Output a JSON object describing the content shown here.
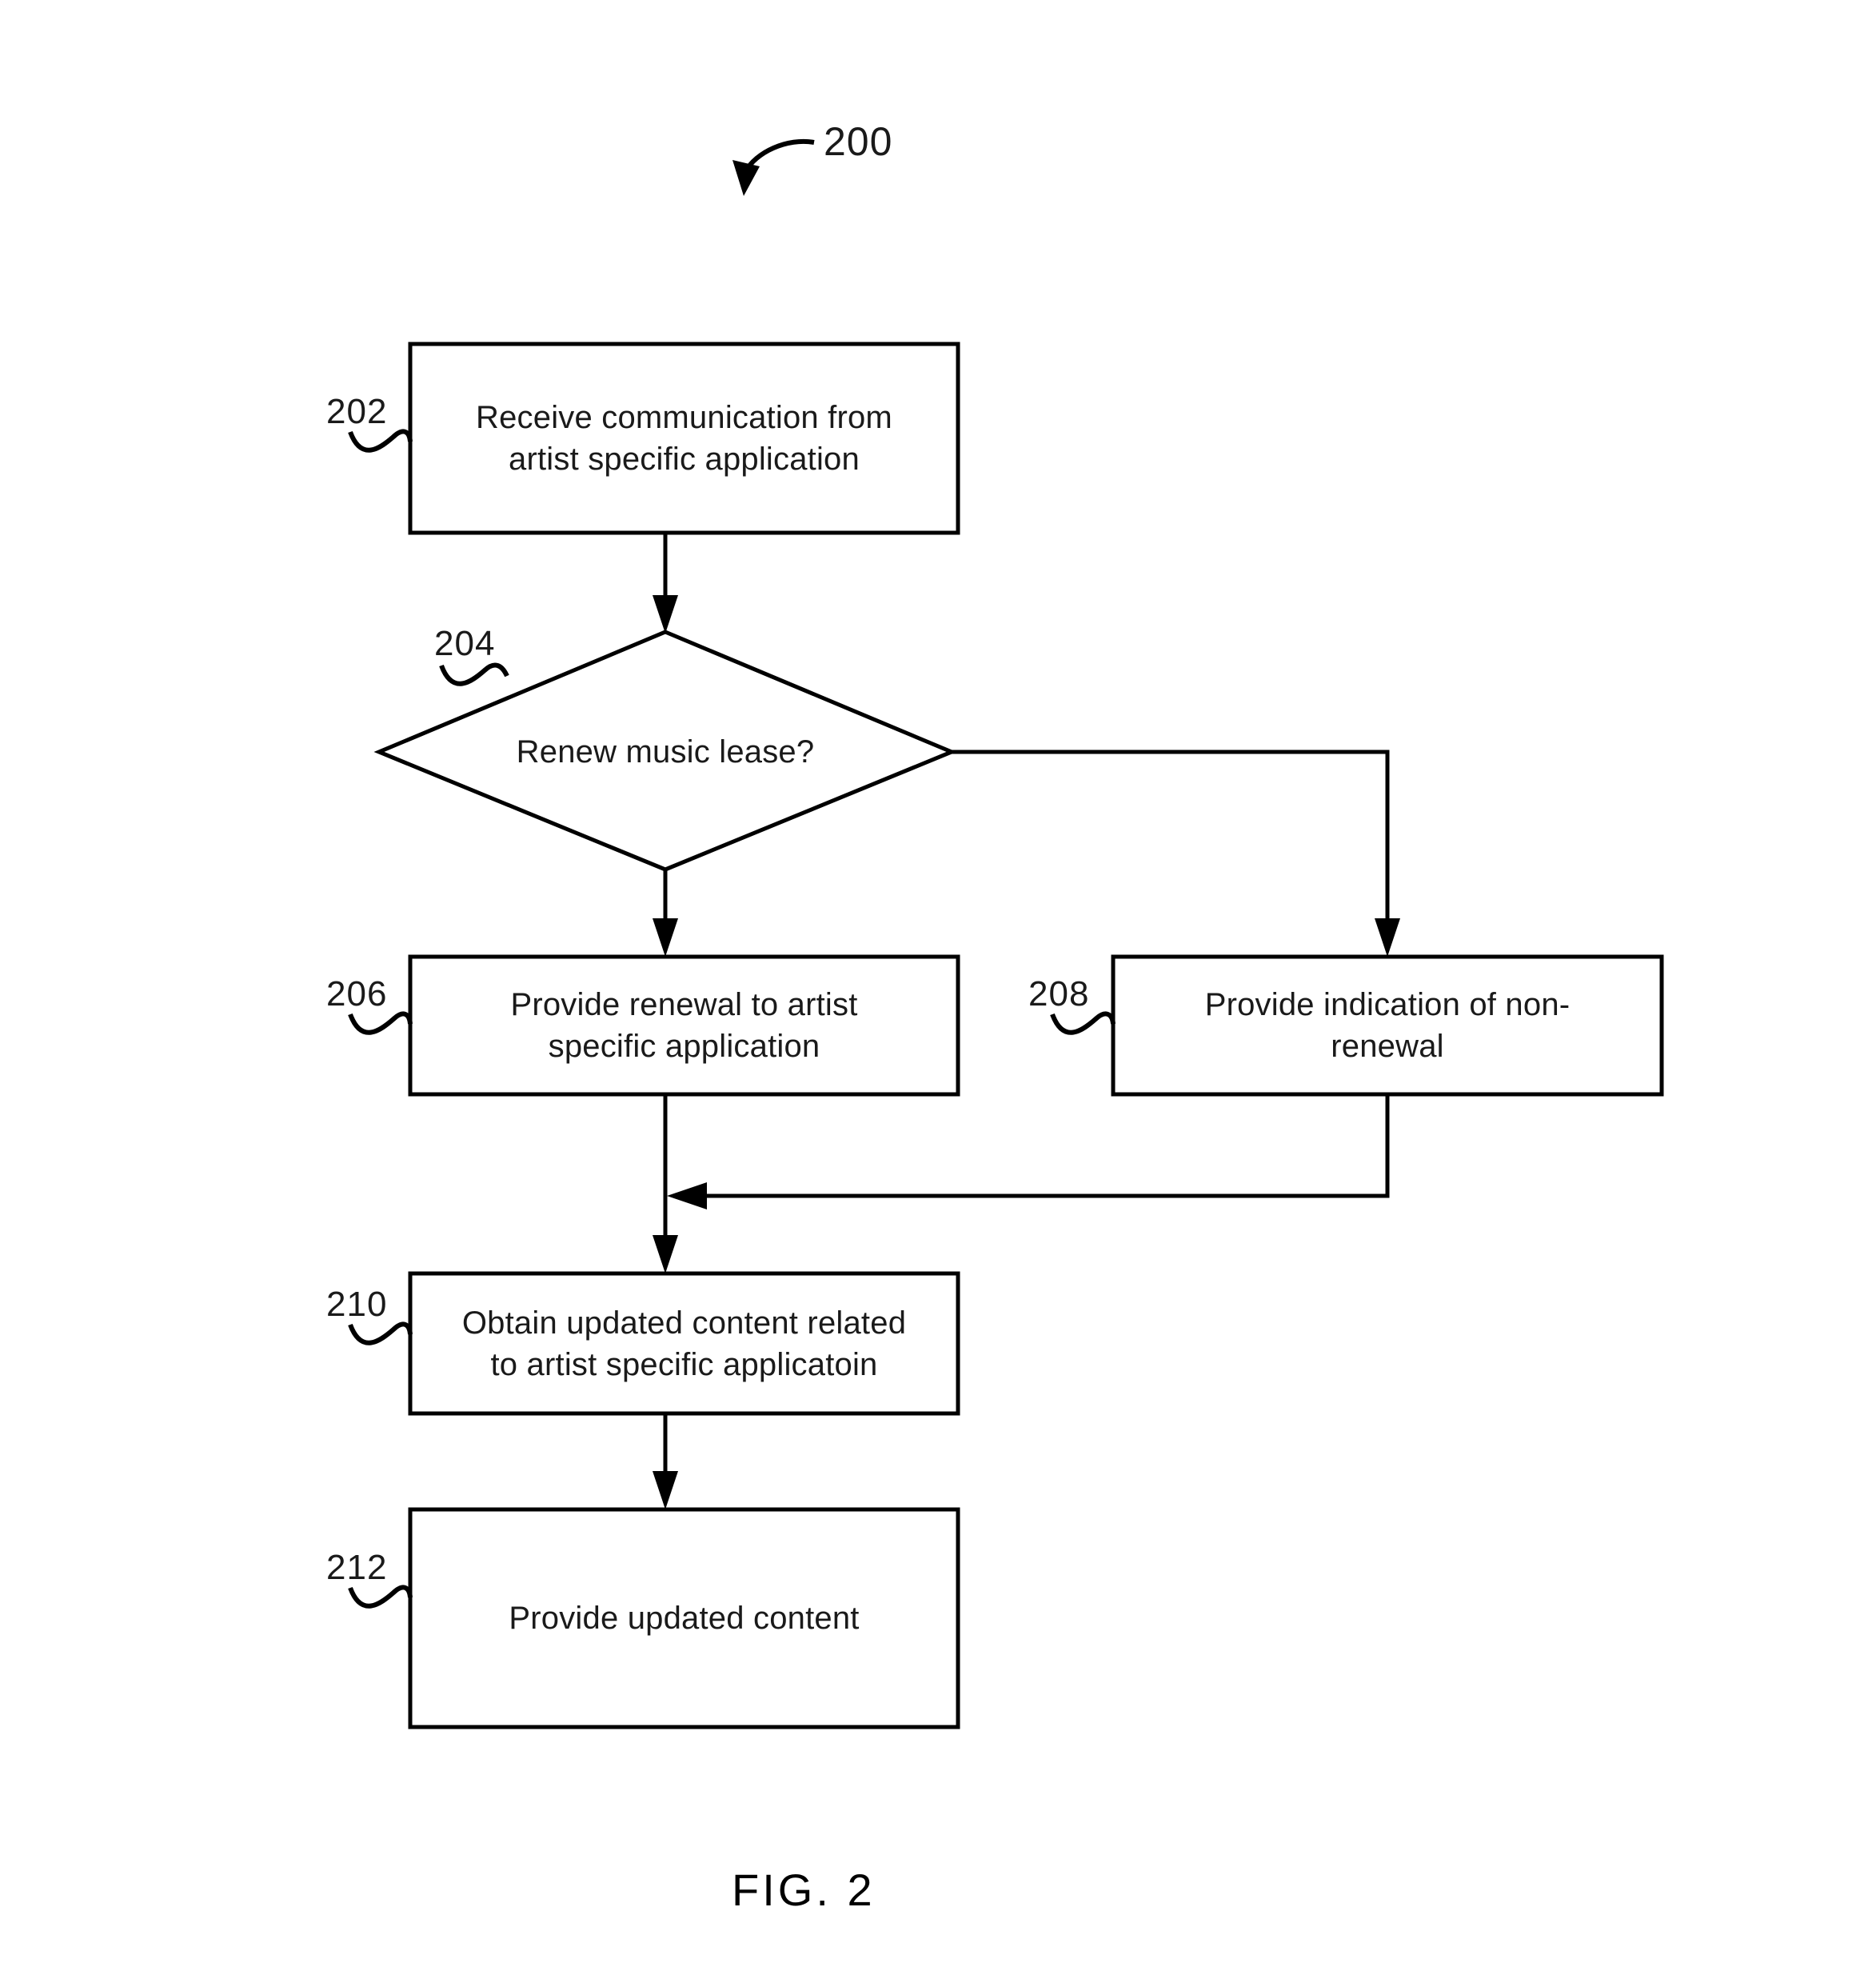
{
  "figure": {
    "caption": "FIG. 2",
    "diagram_ref": "200",
    "background_color": "#ffffff",
    "line_color": "#000000",
    "text_color": "#1a1a1a"
  },
  "nodes": [
    {
      "id": "step-202",
      "ref": "202",
      "shape": "rectangle",
      "text": "Receive communication from\nartist specific application"
    },
    {
      "id": "decision-204",
      "ref": "204",
      "shape": "diamond",
      "text": "Renew music lease?"
    },
    {
      "id": "step-206",
      "ref": "206",
      "shape": "rectangle",
      "text": "Provide renewal to artist\nspecific application"
    },
    {
      "id": "step-208",
      "ref": "208",
      "shape": "rectangle",
      "text": "Provide indication of non-\nrenewal"
    },
    {
      "id": "step-210",
      "ref": "210",
      "shape": "rectangle",
      "text": "Obtain updated content related\nto artist specific applicatoin"
    },
    {
      "id": "step-212",
      "ref": "212",
      "shape": "rectangle",
      "text": "Provide updated content"
    }
  ],
  "edges": [
    {
      "id": "edge-202-204",
      "from": "step-202",
      "to": "decision-204",
      "label": ""
    },
    {
      "id": "edge-204-206",
      "from": "decision-204",
      "to": "step-206",
      "label": ""
    },
    {
      "id": "edge-204-208",
      "from": "decision-204",
      "to": "step-208",
      "label": ""
    },
    {
      "id": "edge-206-210",
      "from": "step-206",
      "to": "step-210",
      "label": ""
    },
    {
      "id": "edge-208-merge",
      "from": "step-208",
      "to": "edge-206-210",
      "label": ""
    },
    {
      "id": "edge-210-212",
      "from": "step-210",
      "to": "step-212",
      "label": ""
    }
  ]
}
